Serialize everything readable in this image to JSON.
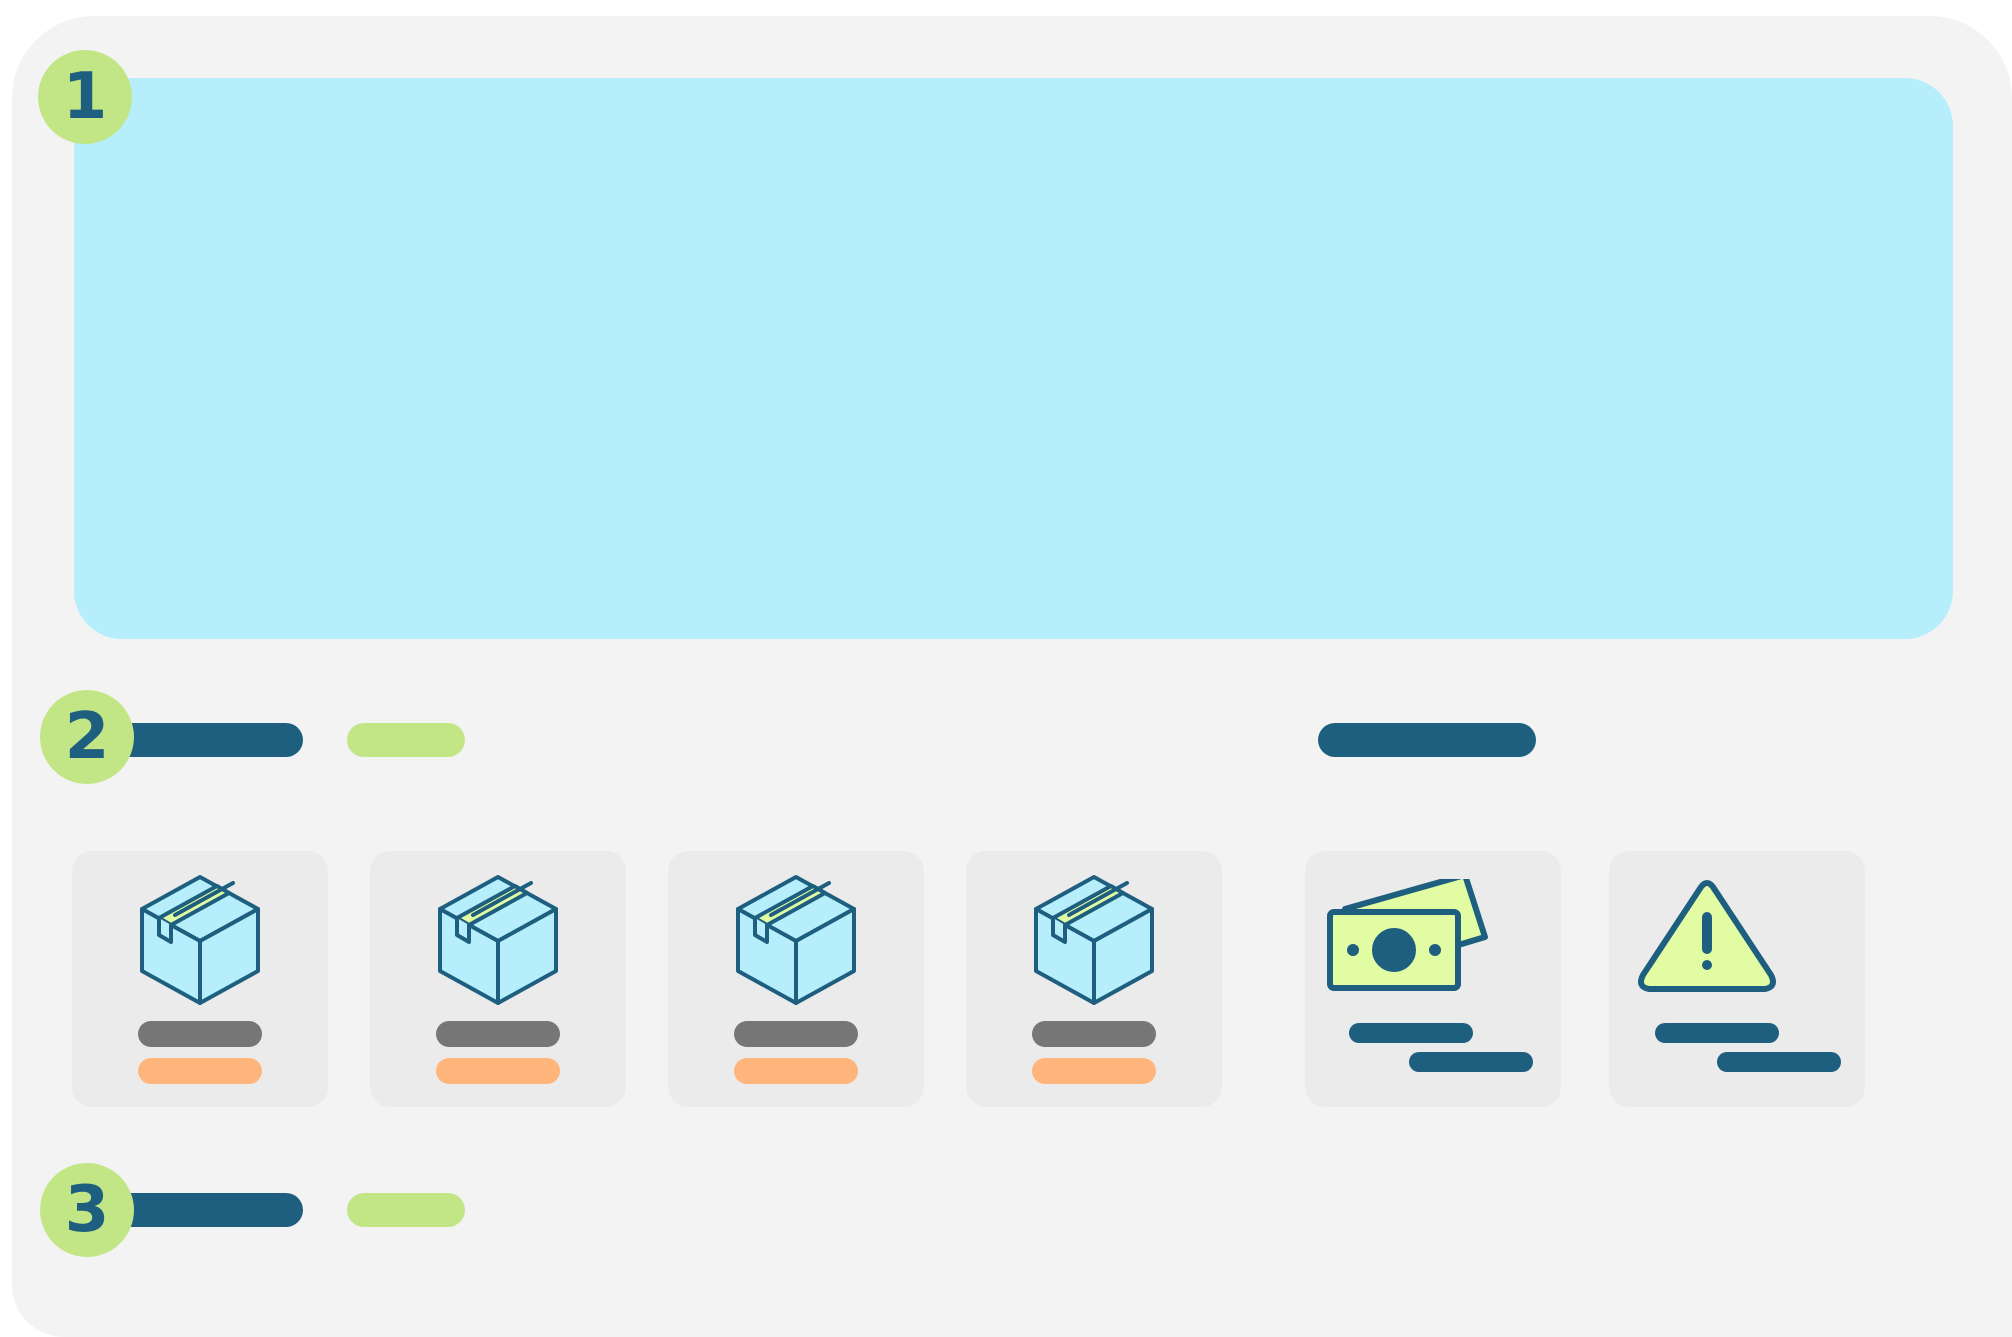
{
  "sections": [
    {
      "number": "1"
    },
    {
      "number": "2"
    },
    {
      "number": "3"
    }
  ],
  "icons": {
    "product": "box-icon",
    "payment": "money-icon",
    "alert": "warning-icon"
  },
  "colors": {
    "accent_navy": "#1e5f80",
    "accent_green": "#c2e686",
    "hero_cyan": "#b6effb",
    "price_orange": "#ffb57b",
    "label_gray": "#767676",
    "money_yellow": "#e2fca4"
  }
}
